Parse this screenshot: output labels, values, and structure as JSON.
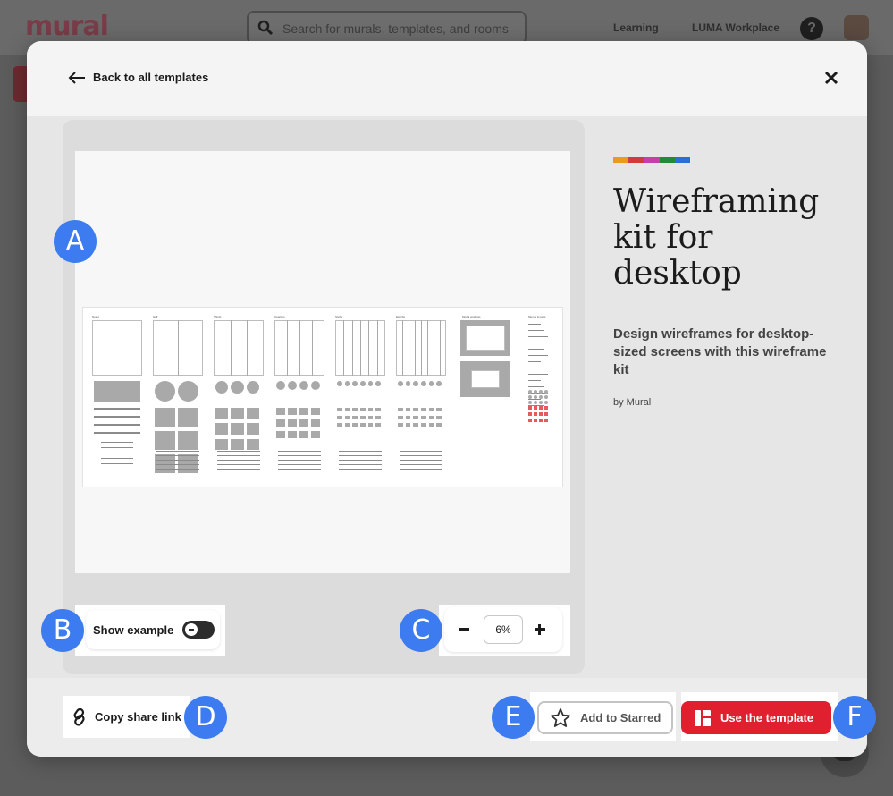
{
  "app": {
    "logo": "mural",
    "search_placeholder": "Search for murals, templates, and rooms",
    "nav": [
      "Learning",
      "LUMA Workplace"
    ],
    "help": "?"
  },
  "modal": {
    "back_label": "Back to all templates",
    "template": {
      "title": "Wireframing kit for desktop",
      "description": "Design wireframes for desktop-sized screens with this wireframe kit",
      "author": "by Mural",
      "stripe_colors": [
        "#e89b1c",
        "#d23b3b",
        "#c53fa8",
        "#1f8a3b",
        "#2b6fd6"
      ]
    },
    "preview": {
      "toggle_label": "Show example",
      "zoom_value": "6%",
      "columns": [
        "Notes",
        "Half",
        "Thirds",
        "Quarters",
        "Sixths",
        "Eighths",
        "Modal windows",
        "Menus & parts"
      ]
    },
    "footer": {
      "share_label": "Copy share link",
      "star_label": "Add to Starred",
      "use_label": "Use the template"
    },
    "badges": [
      "A",
      "B",
      "C",
      "D",
      "E",
      "F"
    ]
  }
}
